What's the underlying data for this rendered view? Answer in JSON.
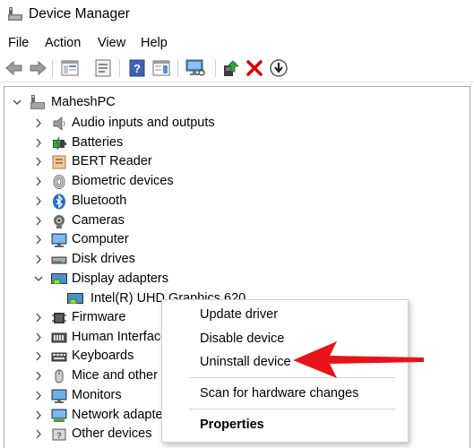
{
  "window": {
    "title": "Device Manager",
    "app_icon": "device-manager-icon"
  },
  "menubar": {
    "items": [
      "File",
      "Action",
      "View",
      "Help"
    ]
  },
  "toolbar": {
    "buttons": [
      "back-icon",
      "forward-icon",
      "show-hide-console-tree-icon",
      "properties-icon",
      "help-icon",
      "action-pane-icon",
      "monitor-scan-icon",
      "update-driver-icon",
      "uninstall-icon",
      "disable-device-icon"
    ]
  },
  "tree": {
    "root": "MaheshPC",
    "items": [
      {
        "label": "Audio inputs and outputs",
        "icon": "speaker-icon",
        "expanded": false
      },
      {
        "label": "Batteries",
        "icon": "battery-icon",
        "expanded": false
      },
      {
        "label": "BERT Reader",
        "icon": "bert-reader-icon",
        "expanded": false
      },
      {
        "label": "Biometric devices",
        "icon": "fingerprint-icon",
        "expanded": false
      },
      {
        "label": "Bluetooth",
        "icon": "bluetooth-icon",
        "expanded": false
      },
      {
        "label": "Cameras",
        "icon": "camera-icon",
        "expanded": false
      },
      {
        "label": "Computer",
        "icon": "computer-icon",
        "expanded": false
      },
      {
        "label": "Disk drives",
        "icon": "disk-drive-icon",
        "expanded": false
      },
      {
        "label": "Display adapters",
        "icon": "display-adapter-icon",
        "expanded": true
      },
      {
        "label": "Firmware",
        "icon": "firmware-icon",
        "expanded": false
      },
      {
        "label": "Human Interface",
        "icon": "human-interface-icon",
        "expanded": false
      },
      {
        "label": "Keyboards",
        "icon": "keyboard-icon",
        "expanded": false
      },
      {
        "label": "Mice and other p",
        "icon": "mouse-icon",
        "expanded": false
      },
      {
        "label": "Monitors",
        "icon": "monitor-icon",
        "expanded": false
      },
      {
        "label": "Network adapte",
        "icon": "network-adapter-icon",
        "expanded": false
      },
      {
        "label": "Other devices",
        "icon": "other-devices-icon",
        "expanded": false
      }
    ],
    "child_item": {
      "label": "Intel(R) UHD Graphics 620",
      "icon": "display-adapter-icon"
    }
  },
  "context_menu": {
    "items": [
      "Update driver",
      "Disable device",
      "Uninstall device",
      "Scan for hardware changes",
      "Properties"
    ]
  },
  "annotation": {
    "arrow_color": "#e8131a",
    "points_to": "Uninstall device"
  },
  "colors": {
    "selection_blue": "#0078d7",
    "arrow_red": "#e8131a",
    "delete_red": "#d40000"
  }
}
